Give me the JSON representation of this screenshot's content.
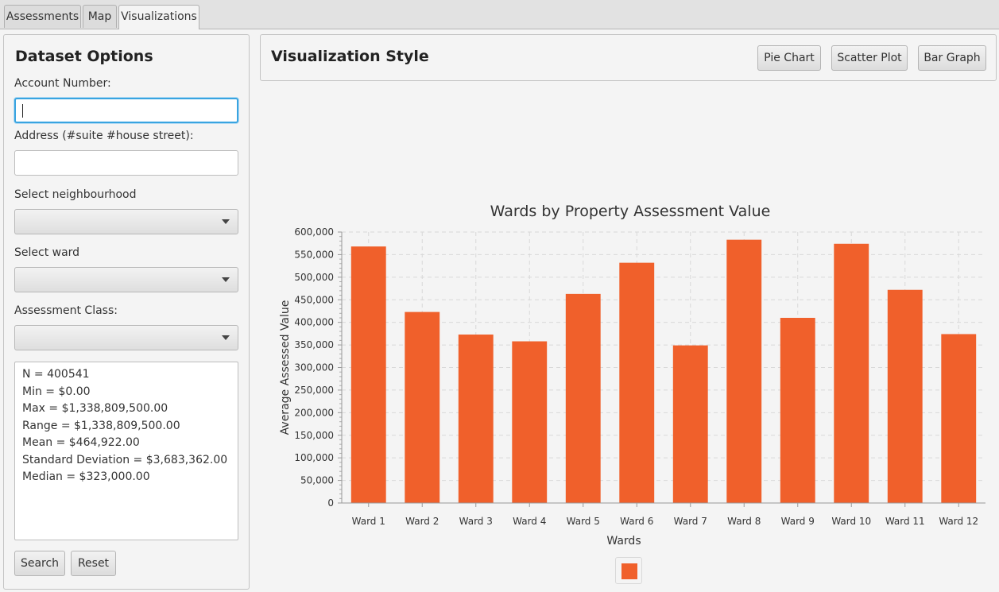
{
  "tabs": [
    {
      "label": "Assessments"
    },
    {
      "label": "Map"
    },
    {
      "label": "Visualizations"
    }
  ],
  "dataset": {
    "title": "Dataset Options",
    "account_label": "Account Number:",
    "account_value": "",
    "address_label": "Address (#suite #house street):",
    "address_value": "",
    "neighbourhood_label": "Select neighbourhood",
    "neighbourhood_value": "",
    "ward_label": "Select ward",
    "ward_value": "",
    "class_label": "Assessment Class:",
    "class_value": "",
    "stats": [
      "N = 400541",
      "Min = $0.00",
      "Max = $1,338,809,500.00",
      "Range = $1,338,809,500.00",
      "Mean = $464,922.00",
      "Standard Deviation = $3,683,362.00",
      "Median = $323,000.00"
    ],
    "search_label": "Search",
    "reset_label": "Reset"
  },
  "viz": {
    "title": "Visualization Style",
    "pie_label": "Pie Chart",
    "scatter_label": "Scatter Plot",
    "bar_label": "Bar Graph"
  },
  "colors": {
    "bar": "#f0602b",
    "grid": "#d8d8d8"
  },
  "chart_data": {
    "type": "bar",
    "title": "Wards by Property Assessment Value",
    "xlabel": "Wards",
    "ylabel": "Average Assessed Value",
    "ylim": [
      0,
      600000
    ],
    "yticks": [
      0,
      50000,
      100000,
      150000,
      200000,
      250000,
      300000,
      350000,
      400000,
      450000,
      500000,
      550000,
      600000
    ],
    "ytick_labels": [
      "0",
      "50,000",
      "100,000",
      "150,000",
      "200,000",
      "250,000",
      "300,000",
      "350,000",
      "400,000",
      "450,000",
      "500,000",
      "550,000",
      "600,000"
    ],
    "categories": [
      "Ward 1",
      "Ward 2",
      "Ward 3",
      "Ward 4",
      "Ward 5",
      "Ward 6",
      "Ward 7",
      "Ward 8",
      "Ward 9",
      "Ward 10",
      "Ward 11",
      "Ward 12"
    ],
    "values": [
      568000,
      423000,
      373000,
      358000,
      463000,
      532000,
      349000,
      583000,
      410000,
      574000,
      472000,
      374000
    ],
    "grid": true,
    "legend": "bottom"
  }
}
